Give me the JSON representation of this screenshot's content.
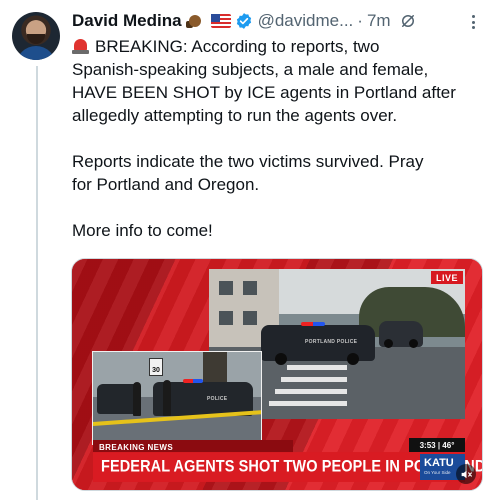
{
  "tweet": {
    "author_name": "David Medina",
    "handle": "@davidme...",
    "separator": "·",
    "time": "7m",
    "icons": {
      "badges": [
        "beaver-emoji-icon",
        "us-flag-icon"
      ],
      "verified": "verified-badge-icon",
      "grok": "grok-icon",
      "more": "more-options-icon",
      "siren": "police-siren-icon"
    },
    "colors": {
      "verified": "#1d9bf0",
      "secondary_text": "#536471",
      "thread_line": "#cfd9de"
    },
    "lines": [
      "BREAKING: According to reports, two",
      "Spanish-speaking subjects, a male and female,",
      "HAVE BEEN SHOT by ICE agents in Portland after",
      "allegedly attempting to run the agents over.",
      "",
      "Reports indicate the two victims survived. Pray",
      "for Portland and Oregon.",
      "",
      "More info to come!"
    ]
  },
  "media": {
    "live_label": "LIVE",
    "speed_sign": "30",
    "car_text_main": "PORTLAND POLICE",
    "car_text_inset": "POLICE",
    "breaking_label": "BREAKING NEWS",
    "headline": "FEDERAL AGENTS SHOT TWO PEOPLE IN PORTLAND",
    "clock": "3:53 | 46°",
    "station": "KATU",
    "station_sub": "On Your Side",
    "colors": {
      "broadcast_red": "#d91b22",
      "live_red": "#d71920",
      "station_blue": "#1b4b9a"
    }
  }
}
